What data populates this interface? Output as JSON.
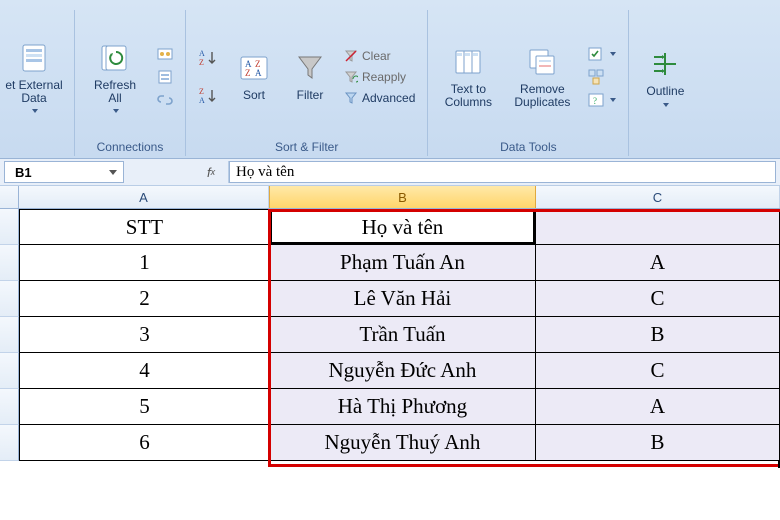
{
  "ribbon": {
    "get_external_data": "et External\nData",
    "refresh_all": "Refresh\nAll",
    "connections_group": "Connections",
    "sort": "Sort",
    "filter": "Filter",
    "clear": "Clear",
    "reapply": "Reapply",
    "advanced": "Advanced",
    "sort_filter_group": "Sort & Filter",
    "text_to_columns": "Text to\nColumns",
    "remove_duplicates": "Remove\nDuplicates",
    "data_tools_group": "Data Tools",
    "outline": "Outline"
  },
  "namebox": "B1",
  "formula": "Họ và tên",
  "columns": {
    "A": "A",
    "B": "B",
    "C": "C"
  },
  "table": {
    "header": {
      "A": "STT",
      "B": "Họ và tên",
      "C": ""
    },
    "rows": [
      {
        "A": "1",
        "B": "Phạm Tuấn An",
        "C": "A"
      },
      {
        "A": "2",
        "B": "Lê Văn Hải",
        "C": "C"
      },
      {
        "A": "3",
        "B": "Trần Tuấn",
        "C": "B"
      },
      {
        "A": "4",
        "B": "Nguyễn Đức Anh",
        "C": "C"
      },
      {
        "A": "5",
        "B": "Hà Thị Phương",
        "C": "A"
      },
      {
        "A": "6",
        "B": "Nguyễn Thuý Anh",
        "C": "B"
      }
    ]
  }
}
